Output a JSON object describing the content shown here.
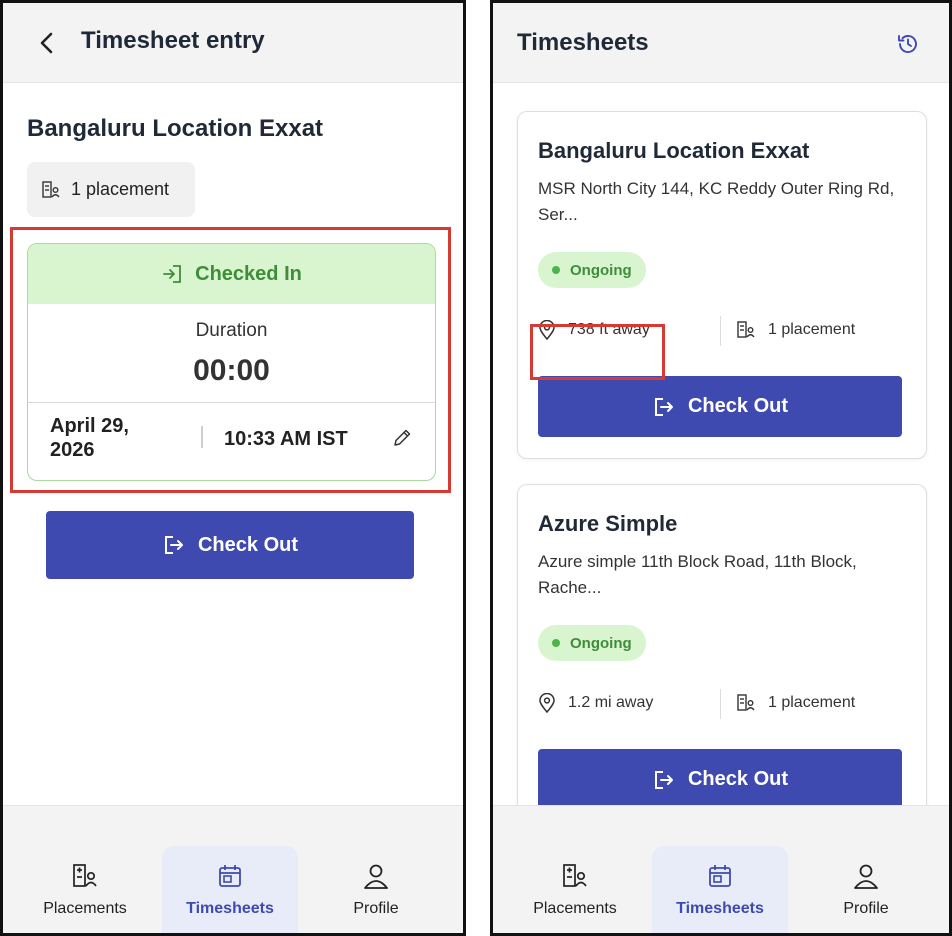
{
  "left": {
    "header": {
      "title": "Timesheet entry"
    },
    "site_title": "Bangaluru Location Exxat",
    "placement_chip": "1 placement",
    "checkin": {
      "status": "Checked In",
      "duration_label": "Duration",
      "duration_value": "00:00",
      "date_line1": "April 29,",
      "date_line2": "2026",
      "time": "10:33 AM IST"
    },
    "checkout_label": "Check Out"
  },
  "right": {
    "header": {
      "title": "Timesheets"
    },
    "cards": [
      {
        "title": "Bangaluru Location Exxat",
        "address": "MSR North City 144, KC Reddy Outer Ring Rd, Ser...",
        "status": "Ongoing",
        "distance": "738 ft away",
        "placements": "1 placement",
        "checkout_label": "Check Out"
      },
      {
        "title": "Azure Simple",
        "address": "Azure simple 11th Block Road, 11th Block, Rache...",
        "status": "Ongoing",
        "distance": "1.2 mi away",
        "placements": "1 placement",
        "checkout_label": "Check Out"
      }
    ]
  },
  "nav": {
    "items": [
      {
        "label": "Placements",
        "icon": "placements-icon",
        "active": false
      },
      {
        "label": "Timesheets",
        "icon": "calendar-icon",
        "active": true
      },
      {
        "label": "Profile",
        "icon": "profile-icon",
        "active": false
      }
    ]
  },
  "colors": {
    "primary": "#3f4ab0",
    "success_bg": "#d9f5cf",
    "success_text": "#3f8d3a",
    "highlight": "#d63a32"
  }
}
